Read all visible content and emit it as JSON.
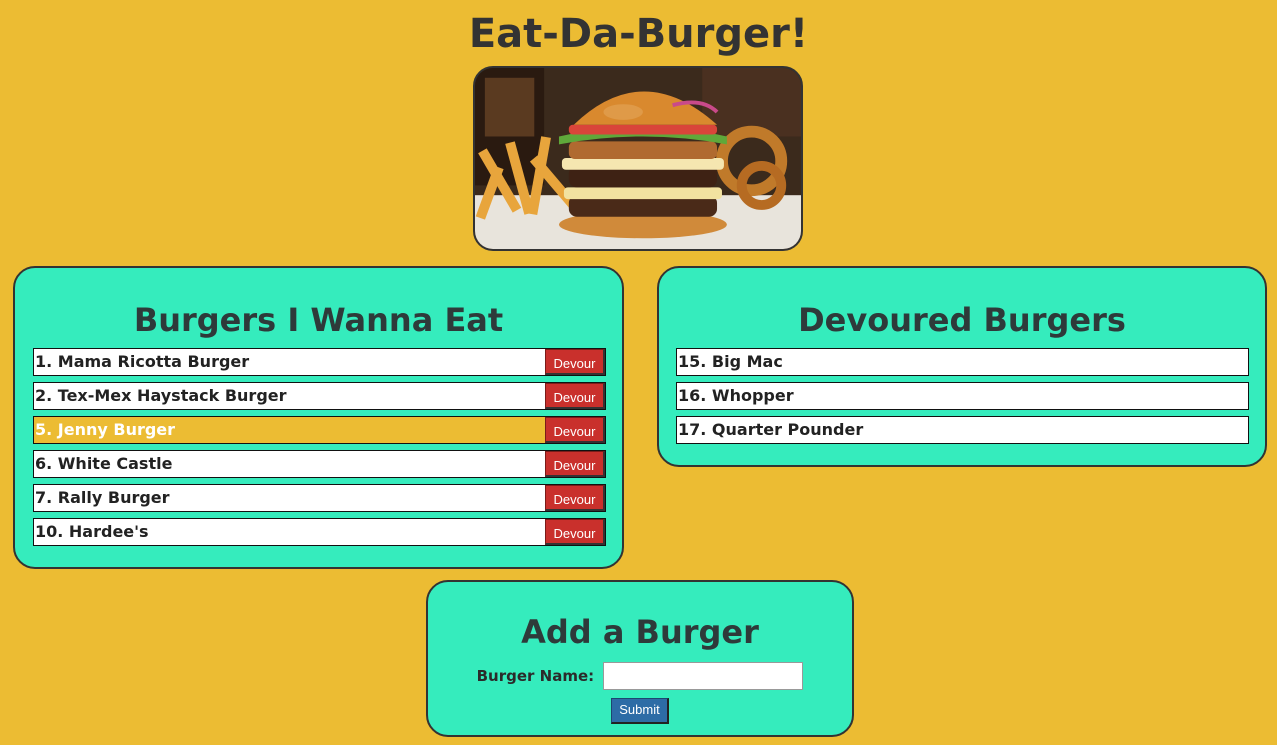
{
  "header": {
    "title": "Eat-Da-Burger!"
  },
  "hero_image": {
    "icon": "burger-photo"
  },
  "wanna_eat": {
    "heading": "Burgers I Wanna Eat",
    "button_label": "Devour",
    "items": [
      {
        "label": "1. Mama Ricotta Burger",
        "highlighted": false
      },
      {
        "label": "2. Tex-Mex Haystack Burger",
        "highlighted": false
      },
      {
        "label": "5. Jenny Burger",
        "highlighted": true
      },
      {
        "label": "6. White Castle",
        "highlighted": false
      },
      {
        "label": "7. Rally Burger",
        "highlighted": false
      },
      {
        "label": "10. Hardee's",
        "highlighted": false
      }
    ]
  },
  "devoured": {
    "heading": "Devoured Burgers",
    "items": [
      {
        "label": "15. Big Mac"
      },
      {
        "label": "16. Whopper"
      },
      {
        "label": "17. Quarter Pounder"
      }
    ]
  },
  "add_form": {
    "heading": "Add a Burger",
    "name_label": "Burger Name:",
    "name_value": "",
    "submit_label": "Submit"
  },
  "colors": {
    "background": "#ecbc33",
    "panel": "#35ecbd",
    "devour_button": "#c9302c",
    "submit_button": "#2d6ca6"
  }
}
